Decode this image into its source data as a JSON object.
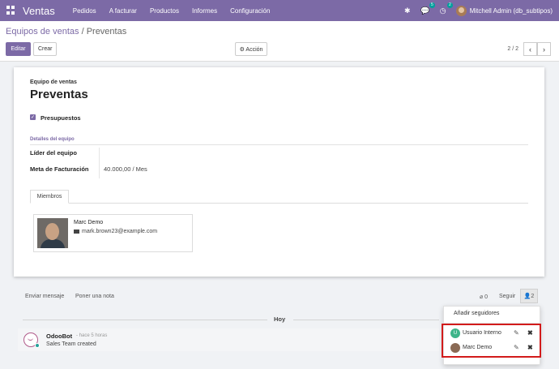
{
  "navbar": {
    "brand": "Ventas",
    "menu": [
      "Pedidos",
      "A facturar",
      "Productos",
      "Informes",
      "Configuración"
    ],
    "messages_badge": "5",
    "activities_badge": "2",
    "user": "Mitchell Admin (db_subtipos)",
    "accent_color": "#7c6aa6"
  },
  "control": {
    "breadcrumb_parent": "Equipos de ventas",
    "breadcrumb_sep": " / ",
    "breadcrumb_current": "Preventas",
    "edit_label": "Editar",
    "create_label": "Crear",
    "action_label": "⚙ Acción",
    "pager": "2 / 2"
  },
  "form": {
    "label": "Equipo de ventas",
    "title": "Preventas",
    "checkbox_label": "Presupuestos",
    "group_title": "Detalles del equipo",
    "leader_label": "Líder del equipo",
    "leader_value": "",
    "target_label": "Meta de Facturación",
    "target_value": "40.000,00",
    "target_unit": "/ Mes",
    "tab_members": "Miembros",
    "member": {
      "name": "Marc Demo",
      "email": "mark.brown23@example.com"
    }
  },
  "chatter": {
    "send_message": "Enviar mensaje",
    "log_note": "Poner una nota",
    "attachments": "0",
    "follow": "Seguir",
    "followers_count": "2",
    "day": "Hoy",
    "message": {
      "author": "OdooBot",
      "date": "- hace 5 horas",
      "body": "Sales Team created"
    }
  },
  "followers_dropdown": {
    "add_label": "Añadir seguidores",
    "followers": [
      {
        "name": "Usuario Interno",
        "initial": "U",
        "color": "#3eb489"
      },
      {
        "name": "Marc Demo",
        "initial": "",
        "color": "#8a6a55"
      }
    ],
    "highlight_color": "#d21b1b"
  }
}
